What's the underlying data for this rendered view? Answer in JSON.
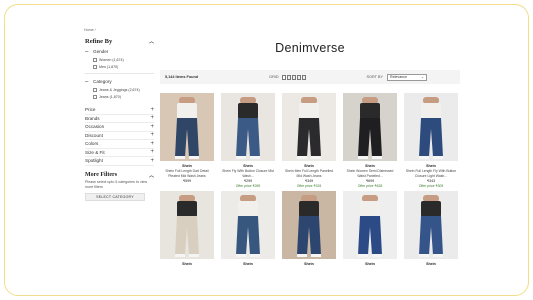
{
  "breadcrumb": "Home /",
  "sidebar": {
    "refine_title": "Refine By",
    "gender": {
      "label": "Gender",
      "options": [
        "Women (1,674)",
        "Men (1,870)"
      ]
    },
    "category": {
      "label": "Category",
      "options": [
        "Jeans & Jeggings (2,674)",
        "Jeans (1,870)"
      ]
    },
    "collapsed": [
      "Price",
      "Brands",
      "Occasion",
      "Discount",
      "Colors",
      "Size & Fit",
      "Spotlight"
    ],
    "more_filters": {
      "title": "More Filters",
      "description": "Please select upto 5 categories to view more filters",
      "button": "SELECT CATEGORY"
    }
  },
  "page_title": "Denimverse",
  "toolbar": {
    "items_found": "5,144 Items Found",
    "grid_label": "GRID",
    "sort_label": "SORT BY",
    "sort_value": "Relevance"
  },
  "products": [
    {
      "brand": "Shein",
      "name": "Shein Full Length Dart Detail Pleated Mid Wash Jeans",
      "price": "₹599",
      "offer": "",
      "wash": "#2f4667",
      "bg": "#d9c7b5"
    },
    {
      "brand": "Shein",
      "name": "Shein Fly With Button Closure Mid Wash...",
      "price": "₹299",
      "offer": "Offer price ₹269",
      "wash": "#3b5a85",
      "bg": "#e9e6e1"
    },
    {
      "brand": "Shein",
      "name": "Shein Men Full Length Panelled Mid Wash Jeans",
      "price": "₹349",
      "offer": "Offer price ₹315",
      "wash": "#2b2b2e",
      "bg": "#ece9e4"
    },
    {
      "brand": "Shein",
      "name": "Shein Women Semi Distressed Waist Panelled...",
      "price": "₹699",
      "offer": "Offer price ₹628",
      "wash": "#1f1f22",
      "bg": "#d6d3cc"
    },
    {
      "brand": "Shein",
      "name": "Shein Full Length Fly With Button Closure Light Wash...",
      "price": "₹343",
      "offer": "Offer price ₹309",
      "wash": "#2e4b7d",
      "bg": "#ebebec"
    },
    {
      "brand": "Shein",
      "name": "",
      "price": "",
      "offer": "",
      "wash": "#d9cfc0",
      "bg": "#e8e4de"
    },
    {
      "brand": "Shein",
      "name": "",
      "price": "",
      "offer": "",
      "wash": "#37577f",
      "bg": "#ecebe8"
    },
    {
      "brand": "Shein",
      "name": "",
      "price": "",
      "offer": "",
      "wash": "#2c4670",
      "bg": "#c9b6a3"
    },
    {
      "brand": "Shein",
      "name": "",
      "price": "",
      "offer": "",
      "wash": "#2b4a86",
      "bg": "#eeeeee"
    },
    {
      "brand": "Shein",
      "name": "",
      "price": "",
      "offer": "",
      "wash": "#35558a",
      "bg": "#ebebeb"
    }
  ]
}
